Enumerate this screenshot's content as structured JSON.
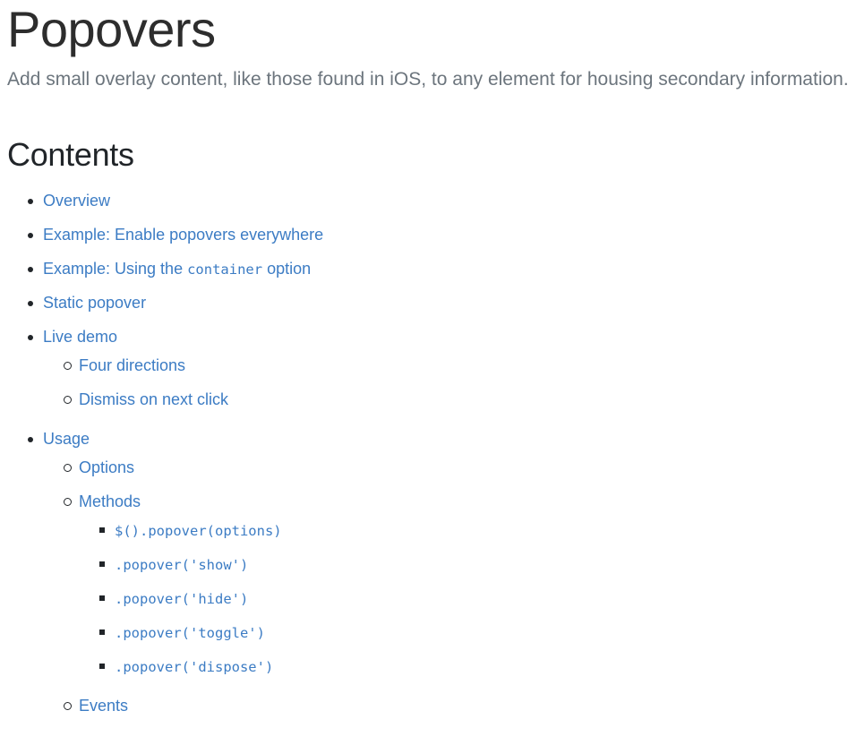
{
  "page": {
    "title": "Popovers",
    "lead": "Add small overlay content, like those found in iOS, to any element for housing secondary information.",
    "contents_heading": "Contents",
    "link_color": "#3c7cc4",
    "title_color": "#2d2d2d",
    "lead_color": "#6c757d"
  },
  "toc": [
    {
      "label": "Overview",
      "type": "text",
      "children": []
    },
    {
      "label": "Example: Enable popovers everywhere",
      "type": "text",
      "children": []
    },
    {
      "label_prefix": "Example: Using the ",
      "label_code": "container",
      "label_suffix": " option",
      "type": "mixed",
      "children": []
    },
    {
      "label": "Static popover",
      "type": "text",
      "children": []
    },
    {
      "label": "Live demo",
      "type": "text",
      "children": [
        {
          "label": "Four directions",
          "type": "text",
          "children": []
        },
        {
          "label": "Dismiss on next click",
          "type": "text",
          "children": []
        }
      ]
    },
    {
      "label": "Usage",
      "type": "text",
      "children": [
        {
          "label": "Options",
          "type": "text",
          "children": []
        },
        {
          "label": "Methods",
          "type": "text",
          "children": [
            {
              "label": "$().popover(options)",
              "type": "code"
            },
            {
              "label": ".popover('show')",
              "type": "code"
            },
            {
              "label": ".popover('hide')",
              "type": "code"
            },
            {
              "label": ".popover('toggle')",
              "type": "code"
            },
            {
              "label": ".popover('dispose')",
              "type": "code"
            }
          ]
        },
        {
          "label": "Events",
          "type": "text",
          "children": []
        }
      ]
    }
  ]
}
